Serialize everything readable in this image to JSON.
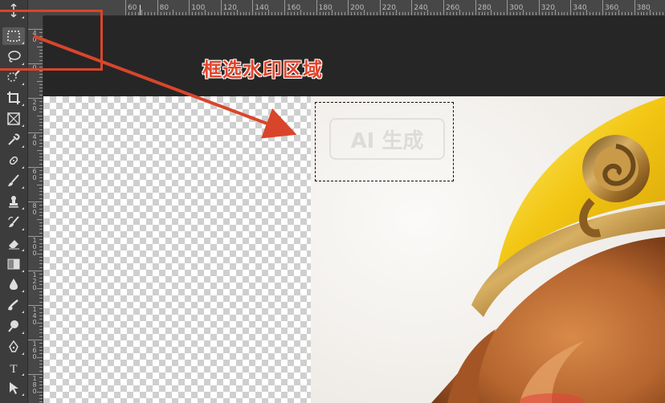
{
  "toolbar": {
    "tools": [
      {
        "name": "move-tool",
        "icon": "move-icon",
        "active": false
      },
      {
        "name": "rectangular-marquee-tool",
        "icon": "marquee-icon",
        "active": true
      },
      {
        "name": "lasso-tool",
        "icon": "lasso-icon",
        "active": false
      },
      {
        "name": "quick-selection-tool",
        "icon": "quick-selection-icon",
        "active": false
      },
      {
        "name": "crop-tool",
        "icon": "crop-icon",
        "active": false
      },
      {
        "name": "frame-tool",
        "icon": "frame-icon",
        "active": false
      },
      {
        "name": "eyedropper-tool",
        "icon": "eyedropper-icon",
        "active": false
      },
      {
        "name": "healing-brush-tool",
        "icon": "bandage-icon",
        "active": false
      },
      {
        "name": "brush-tool",
        "icon": "brush-icon",
        "active": false
      },
      {
        "name": "clone-stamp-tool",
        "icon": "stamp-icon",
        "active": false
      },
      {
        "name": "history-brush-tool",
        "icon": "history-brush-icon",
        "active": false
      },
      {
        "name": "eraser-tool",
        "icon": "eraser-icon",
        "active": false
      },
      {
        "name": "gradient-tool",
        "icon": "gradient-icon",
        "active": false
      },
      {
        "name": "blur-tool",
        "icon": "drop-icon",
        "active": false
      },
      {
        "name": "smudge-tool",
        "icon": "smudge-icon",
        "active": false
      },
      {
        "name": "dodge-tool",
        "icon": "dodge-icon",
        "active": false
      },
      {
        "name": "pen-tool",
        "icon": "pen-icon",
        "active": false
      },
      {
        "name": "type-tool",
        "icon": "type-icon",
        "label": "T",
        "active": false
      },
      {
        "name": "path-selection-tool",
        "icon": "arrow-icon",
        "active": false
      }
    ]
  },
  "ruler": {
    "horizontal_labels": [
      "60",
      "80",
      "100",
      "120",
      "140",
      "160",
      "180",
      "200",
      "220",
      "240",
      "260",
      "280",
      "300",
      "320",
      "340",
      "360",
      "380"
    ],
    "vertical_labels": [
      "4\n0",
      "0",
      "2\n0",
      "4\n0",
      "6\n0",
      "8\n0",
      "1\n0\n0",
      "1\n2\n0",
      "1\n4\n0",
      "1\n6\n0",
      "1\n8\n0"
    ]
  },
  "annotation": {
    "text": "框选水印区域",
    "color": "#e2452b"
  },
  "canvas": {
    "watermark_text": "AI 生成"
  },
  "colors": {
    "accent_red": "#d9452b",
    "crown_gold": "#f2c613",
    "fur": "#b5652e"
  }
}
